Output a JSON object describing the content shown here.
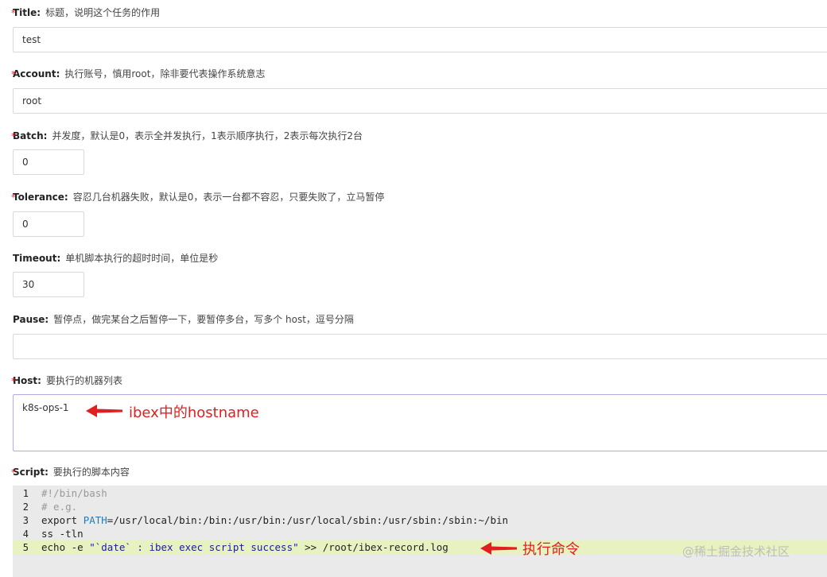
{
  "fields": {
    "title": {
      "key": "Title:",
      "desc": "标题，说明这个任务的作用",
      "value": "test",
      "required": true
    },
    "account": {
      "key": "Account:",
      "desc": "执行账号，慎用root，除非要代表操作系统意志",
      "value": "root",
      "required": true
    },
    "batch": {
      "key": "Batch:",
      "desc": "并发度，默认是0，表示全并发执行，1表示顺序执行，2表示每次执行2台",
      "value": "0",
      "required": true
    },
    "tolerance": {
      "key": "Tolerance:",
      "desc": "容忍几台机器失败，默认是0，表示一台都不容忍，只要失败了，立马暂停",
      "value": "0",
      "required": true
    },
    "timeout": {
      "key": "Timeout:",
      "desc": "单机脚本执行的超时时间，单位是秒",
      "value": "30",
      "required": false
    },
    "pause": {
      "key": "Pause:",
      "desc": "暂停点，做完某台之后暂停一下，要暂停多台，写多个 host，逗号分隔",
      "value": "",
      "required": false
    },
    "host": {
      "key": "Host:",
      "desc": "要执行的机器列表",
      "value": "k8s-ops-1",
      "required": true
    },
    "script": {
      "key": "Script:",
      "desc": "要执行的脚本内容",
      "required": true
    }
  },
  "required_mark": "*",
  "script_lines": [
    {
      "num": "1",
      "text": "#!/bin/bash"
    },
    {
      "num": "2",
      "text": "# e.g."
    },
    {
      "num": "3",
      "p1": "export ",
      "p2": "PATH",
      "p3": "=/usr/local/bin:/bin:/usr/bin:/usr/local/sbin:/usr/sbin:/sbin:~/bin"
    },
    {
      "num": "4",
      "text": "ss -tln"
    },
    {
      "num": "5",
      "p1": "echo -e ",
      "p2": "\"`date` : ibex exec script success\"",
      "p3": " >> /root/ibex-record.log"
    }
  ],
  "annotations": {
    "host_note": "ibex中的hostname",
    "script_note": "执行命令"
  },
  "watermark": "@稀土掘金技术社区",
  "colors": {
    "required": "#f5222d",
    "annotation": "#e02020",
    "active_line": "#e8f2c0"
  }
}
